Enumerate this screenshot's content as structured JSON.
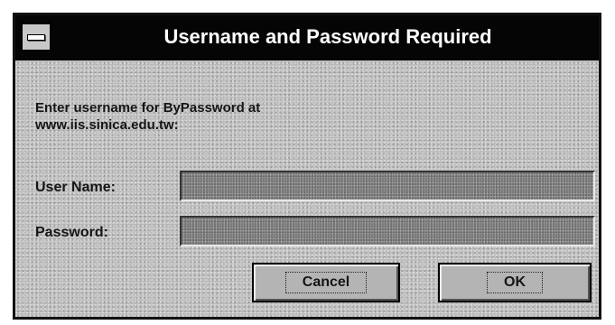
{
  "dialog": {
    "title": "Username and Password Required",
    "prompt_line1": "Enter username for ByPassword at",
    "prompt_line2": "www.iis.sinica.edu.tw:",
    "username_label": "User Name:",
    "username_value": "",
    "password_label": "Password:",
    "password_value": "",
    "cancel_label": "Cancel",
    "ok_label": "OK"
  },
  "icons": {
    "system_menu": "system-menu-icon"
  },
  "colors": {
    "titlebar_bg": "#050505",
    "titlebar_text": "#ffffff",
    "dialog_bg": "#b9b9b9",
    "field_bg": "#8e8e8e"
  }
}
